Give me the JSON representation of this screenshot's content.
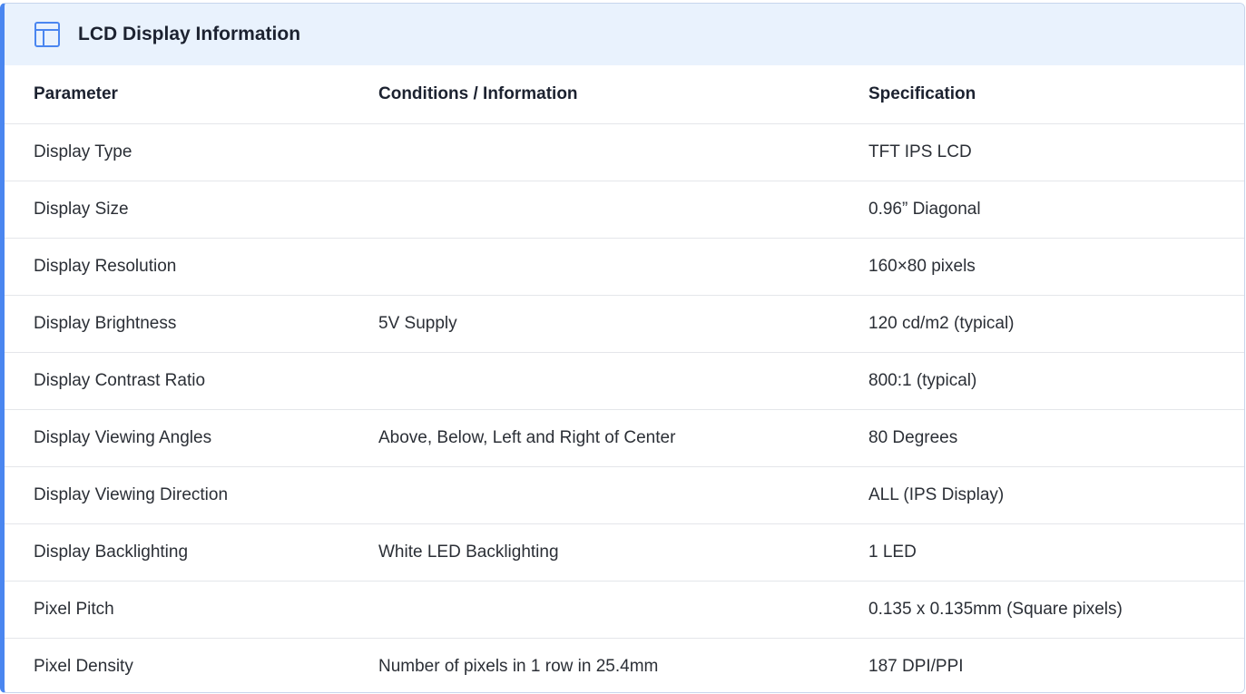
{
  "header": {
    "icon": "table-icon",
    "title": "LCD Display Information"
  },
  "colors": {
    "accent": "#4a86f0",
    "header_bg": "#e9f2fd"
  },
  "table": {
    "columns": [
      "Parameter",
      "Conditions / Information",
      "Specification"
    ],
    "rows": [
      [
        "Display Type",
        "",
        "TFT IPS LCD"
      ],
      [
        "Display Size",
        "",
        "0.96” Diagonal"
      ],
      [
        "Display Resolution",
        "",
        "160×80 pixels"
      ],
      [
        "Display Brightness",
        "5V Supply",
        "120 cd/m2 (typical)"
      ],
      [
        "Display Contrast Ratio",
        "",
        "800:1 (typical)"
      ],
      [
        "Display Viewing Angles",
        "Above, Below, Left and Right of Center",
        "80 Degrees"
      ],
      [
        "Display Viewing Direction",
        "",
        "ALL (IPS Display)"
      ],
      [
        "Display Backlighting",
        "White LED Backlighting",
        "1 LED"
      ],
      [
        "Pixel Pitch",
        "",
        "0.135 x 0.135mm (Square pixels)"
      ],
      [
        "Pixel Density",
        "Number of pixels in 1 row in 25.4mm",
        "187 DPI/PPI"
      ]
    ]
  }
}
